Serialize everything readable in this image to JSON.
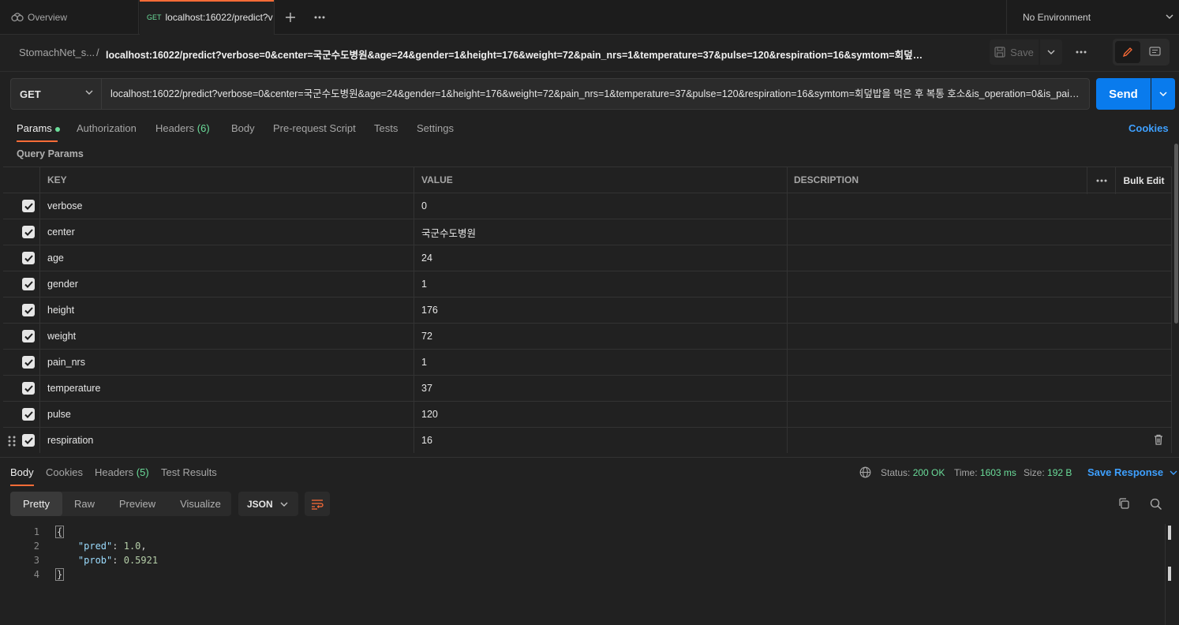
{
  "tabs": {
    "overview_label": "Overview",
    "active_method": "GET",
    "active_label": "localhost:16022/predict?v"
  },
  "environment": {
    "label": "No Environment"
  },
  "breadcrumb": {
    "collection": "StomachNet_s...",
    "separator": "/",
    "request": "localhost:16022/predict?verbose=0&center=국군수도병원&age=24&gender=1&height=176&weight=72&pain_nrs=1&temperature=37&pulse=120&respiration=16&symtom=회덮밥을 ..."
  },
  "toolbar": {
    "save_label": "Save"
  },
  "request": {
    "method": "GET",
    "url": "localhost:16022/predict?verbose=0&center=국군수도병원&age=24&gender=1&height=176&weight=72&pain_nrs=1&temperature=37&pulse=120&respiration=16&symtom=회덮밥을 먹은 후 복통 호소&is_operation=0&is_pain ...",
    "send_label": "Send"
  },
  "request_tabs": {
    "params": "Params",
    "authorization": "Authorization",
    "headers": "Headers",
    "headers_count": "(6)",
    "body": "Body",
    "prerequest": "Pre-request Script",
    "tests": "Tests",
    "settings": "Settings",
    "cookies": "Cookies"
  },
  "query_params": {
    "title": "Query Params",
    "headers": {
      "key": "KEY",
      "value": "VALUE",
      "description": "DESCRIPTION",
      "bulk_edit": "Bulk Edit"
    },
    "rows": [
      {
        "key": "verbose",
        "value": "0"
      },
      {
        "key": "center",
        "value": "국군수도병원"
      },
      {
        "key": "age",
        "value": "24"
      },
      {
        "key": "gender",
        "value": "1"
      },
      {
        "key": "height",
        "value": "176"
      },
      {
        "key": "weight",
        "value": "72"
      },
      {
        "key": "pain_nrs",
        "value": "1"
      },
      {
        "key": "temperature",
        "value": "37"
      },
      {
        "key": "pulse",
        "value": "120"
      },
      {
        "key": "respiration",
        "value": "16"
      }
    ]
  },
  "response_tabs": {
    "body": "Body",
    "cookies": "Cookies",
    "headers": "Headers",
    "headers_count": "(5)",
    "test_results": "Test Results"
  },
  "response_status": {
    "status_label": "Status:",
    "status_value": "200 OK",
    "time_label": "Time:",
    "time_value": "1603 ms",
    "size_label": "Size:",
    "size_value": "192 B",
    "save_response": "Save Response"
  },
  "response_view": {
    "formats": [
      "Pretty",
      "Raw",
      "Preview",
      "Visualize"
    ],
    "language": "JSON"
  },
  "response_body": {
    "line_numbers": [
      "1",
      "2",
      "3",
      "4"
    ],
    "open_brace": "{",
    "pred_key": "\"pred\"",
    "pred_value": "1.0",
    "prob_key": "\"prob\"",
    "prob_value": "0.5921",
    "close_brace": "}"
  },
  "colors": {
    "accent": "#ff6c37",
    "primary": "#097bed",
    "success": "#6bdd9a",
    "background": "#212121"
  }
}
